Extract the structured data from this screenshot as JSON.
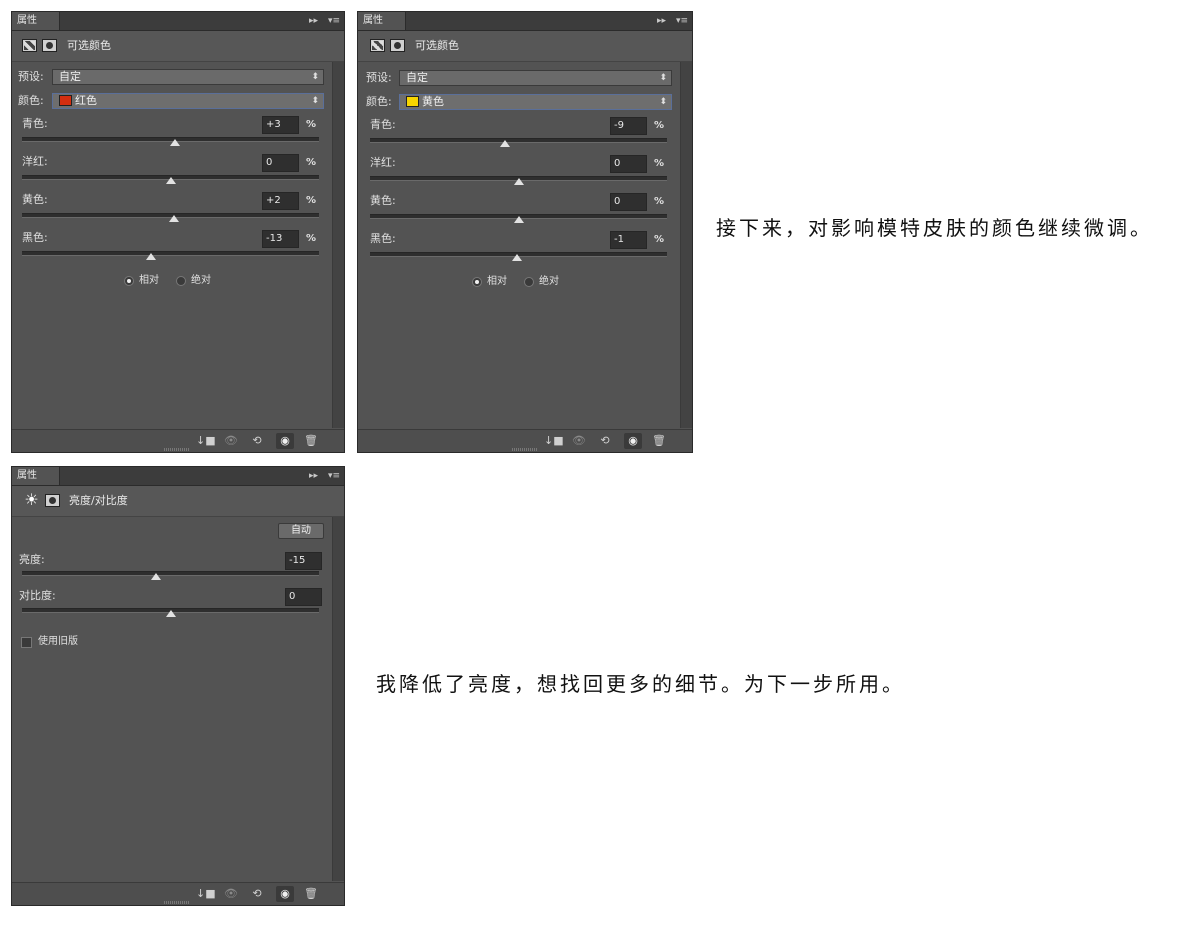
{
  "panels": [
    {
      "tab": "属性",
      "header_title": "可选颜色",
      "preset_label": "预设:",
      "preset_value": "自定",
      "color_label": "颜色:",
      "color_value": "红色",
      "swatch_color": "#d42e10",
      "sliders": [
        {
          "label": "青色:",
          "value": "+3",
          "unit": "%",
          "thumb_fraction": 0.515
        },
        {
          "label": "洋红:",
          "value": "0",
          "unit": "%",
          "thumb_fraction": 0.5
        },
        {
          "label": "黄色:",
          "value": "+2",
          "unit": "%",
          "thumb_fraction": 0.51
        },
        {
          "label": "黑色:",
          "value": "-13",
          "unit": "%",
          "thumb_fraction": 0.435
        }
      ],
      "radio_relative": "相对",
      "radio_absolute": "绝对",
      "selected_mode": "相对"
    },
    {
      "tab": "属性",
      "header_title": "可选颜色",
      "preset_label": "预设:",
      "preset_value": "自定",
      "color_label": "颜色:",
      "color_value": "黄色",
      "swatch_color": "#f7d500",
      "sliders": [
        {
          "label": "青色:",
          "value": "-9",
          "unit": "%",
          "thumb_fraction": 0.455
        },
        {
          "label": "洋红:",
          "value": "0",
          "unit": "%",
          "thumb_fraction": 0.5
        },
        {
          "label": "黄色:",
          "value": "0",
          "unit": "%",
          "thumb_fraction": 0.5
        },
        {
          "label": "黑色:",
          "value": "-1",
          "unit": "%",
          "thumb_fraction": 0.495
        }
      ],
      "radio_relative": "相对",
      "radio_absolute": "绝对",
      "selected_mode": "相对"
    }
  ],
  "bc_panel": {
    "tab": "属性",
    "header_title": "亮度/对比度",
    "auto_label": "自动",
    "brightness_label": "亮度:",
    "brightness_value": "-15",
    "brightness_fraction": 0.45,
    "contrast_label": "对比度:",
    "contrast_value": "0",
    "contrast_fraction": 0.5,
    "legacy_label": "使用旧版",
    "legacy_checked": false
  },
  "footer_icons": [
    "clip-to-layer-icon",
    "view-previous-state-icon",
    "reset-icon",
    "visibility-eye-icon",
    "trash-icon"
  ],
  "panel_menu_glyph": "▸▸",
  "panel_options_glyph": "▾≡",
  "captions": {
    "top": "接下来，对影响模特皮肤的颜色继续微调。",
    "bottom": "我降低了亮度，想找回更多的细节。为下一步所用。"
  }
}
